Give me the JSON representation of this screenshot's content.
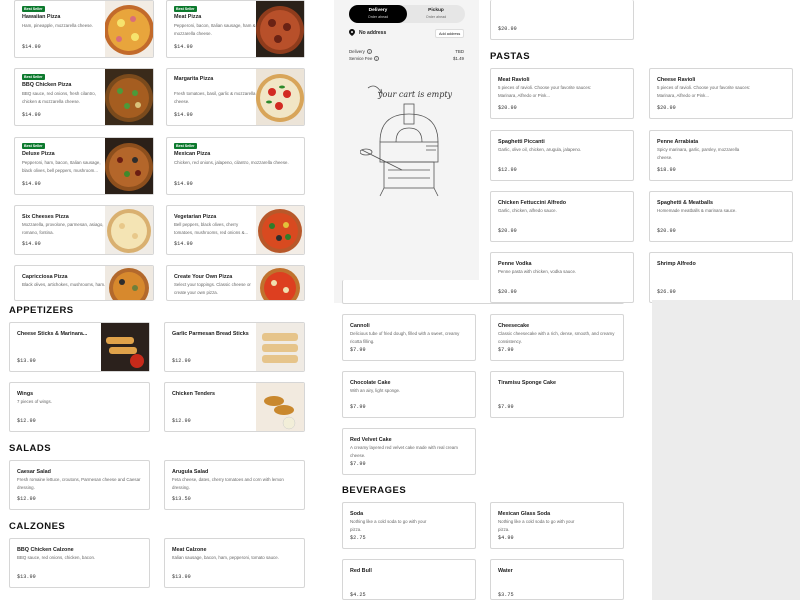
{
  "cart": {
    "tabs": [
      {
        "label": "Delivery",
        "sub": "Order ahead"
      },
      {
        "label": "Pickup",
        "sub": "Order ahead"
      }
    ],
    "address": "No address",
    "add_address": "Add address",
    "delivery_label": "Delivery",
    "delivery_value": "TBD",
    "service_fee_label": "Service Fee",
    "service_fee_value": "$1.49",
    "empty": "your cart is empty"
  },
  "sections": {
    "appetizers": "APPETIZERS",
    "salads": "SALADS",
    "calzones": "CALZONES",
    "pastas": "PASTAS",
    "beverages": "BEVERAGES"
  },
  "badge": "Best Seller",
  "top_price": "$20.99",
  "pizzas": [
    {
      "name": "Hawaiian Pizza",
      "desc": "Ham, pineapple, mozzarella cheese.",
      "price": "$14.99",
      "best": true
    },
    {
      "name": "Meat Pizza",
      "desc": "Pepperoni, bacon, Italian sausage, ham & mozzarella cheese.",
      "price": "$14.99",
      "best": true
    },
    {
      "name": "BBQ Chicken Pizza",
      "desc": "BBQ sauce, red onions, fresh cilantro, chicken & mozzarella cheese.",
      "price": "$14.99",
      "best": true
    },
    {
      "name": "Margarita Pizza",
      "desc": "Fresh tomatoes, basil, garlic & mozzarella cheese.",
      "price": "$14.99",
      "best": false
    },
    {
      "name": "Deluxe Pizza",
      "desc": "Pepperoni, ham, bacon, Italian sausage, black olives, bell peppers, mushroom...",
      "price": "$14.99",
      "best": true
    },
    {
      "name": "Mexican Pizza",
      "desc": "Chicken, red onions, jalapeno, cilantro, mozzarella cheese.",
      "price": "$14.99",
      "best": true
    },
    {
      "name": "Six Cheeses Pizza",
      "desc": "Mozzarella, provolone, parmesan, asiago, romano, fontina.",
      "price": "$14.99",
      "best": false
    },
    {
      "name": "Vegetarian Pizza",
      "desc": "Bell peppers, black olives, cherry tomatoes, mushrooms, red onions &...",
      "price": "$14.99",
      "best": false
    },
    {
      "name": "Capricciosa Pizza",
      "desc": "Black olives, artichokes, mushrooms, ham.",
      "price": "",
      "best": false
    },
    {
      "name": "Create Your Own Pizza",
      "desc": "Select your toppings. Classic cheese or create your own pizza.",
      "price": "",
      "best": false
    }
  ],
  "appetizers": [
    {
      "name": "Cheese Sticks & Marinara...",
      "desc": "",
      "price": "$13.99"
    },
    {
      "name": "Garlic Parmesan Bread Sticks",
      "desc": "",
      "price": "$12.99"
    },
    {
      "name": "Wings",
      "desc": "7 pieces of wings.",
      "price": "$12.99"
    },
    {
      "name": "Chicken Tenders",
      "desc": "",
      "price": "$12.99"
    }
  ],
  "salads": [
    {
      "name": "Caesar Salad",
      "desc": "Fresh romaine lettuce, croutons, Parmesan cheese and Caesar dressing.",
      "price": "$12.99"
    },
    {
      "name": "Arugula Salad",
      "desc": "Feta cheese, dates, cherry tomatoes and corn with lemon dressing.",
      "price": "$13.50"
    }
  ],
  "calzones": [
    {
      "name": "BBQ Chicken Calzone",
      "desc": "BBQ sauce, red onions, chicken, bacon.",
      "price": "$13.99"
    },
    {
      "name": "Meat Calzone",
      "desc": "Italian sausage, bacon, ham, pepperoni, tomato sauce.",
      "price": "$13.99"
    }
  ],
  "pastas": [
    {
      "name": "Meat Ravioli",
      "desc": "5 pieces of ravioli. Choose your favorite sauces: Marinara, Alfredo or Pink...",
      "price": "$20.99"
    },
    {
      "name": "Cheese Ravioli",
      "desc": "5 pieces of ravioli. Choose your favorite sauces: Marinara, Alfredo or Pink...",
      "price": "$20.99"
    },
    {
      "name": "Spaghetti Piccanti",
      "desc": "Garlic, olive oil, chicken, arugula, jalapeno.",
      "price": "$12.99"
    },
    {
      "name": "Penne Arrabiata",
      "desc": "Spicy marinara, garlic, parsley, mozzarella cheese.",
      "price": "$18.99"
    },
    {
      "name": "Chicken Fettuccini Alfredo",
      "desc": "Garlic, chicken, alfredo sauce.",
      "price": "$20.99"
    },
    {
      "name": "Spaghetti & Meatballs",
      "desc": "Homemade meatballs & marinara sauce.",
      "price": "$20.99"
    },
    {
      "name": "Penne Vodka",
      "desc": "Penne pasta with chicken, vodka sauce.",
      "price": "$20.99"
    },
    {
      "name": "Shrimp Alfredo",
      "desc": "",
      "price": "$26.99"
    }
  ],
  "desserts": [
    {
      "name": "Cannoli",
      "desc": "Delicious tube of fried dough, filled with a sweet, creamy ricotta filling.",
      "price": "$7.99"
    },
    {
      "name": "Cheesecake",
      "desc": "Classic cheesecake with a rich, dense, smooth, and creamy consistency.",
      "price": "$7.99"
    },
    {
      "name": "Chocolate Cake",
      "desc": "With an airy, light sponge.",
      "price": "$7.99"
    },
    {
      "name": "Tiramisu Sponge Cake",
      "desc": "",
      "price": "$7.99"
    },
    {
      "name": "Red Velvet Cake",
      "desc": "A creamy layered red velvet cake made with real cream cheese.",
      "price": "$7.99"
    }
  ],
  "beverages": [
    {
      "name": "Soda",
      "desc": "Nothing like a cold soda to go with your pizza.",
      "price": "$2.75"
    },
    {
      "name": "Mexican Glass Soda",
      "desc": "Nothing like a cold soda to go with your pizza.",
      "price": "$4.99"
    },
    {
      "name": "Red Bull",
      "desc": "",
      "price": "$4.25"
    },
    {
      "name": "Water",
      "desc": "",
      "price": "$3.75"
    }
  ]
}
